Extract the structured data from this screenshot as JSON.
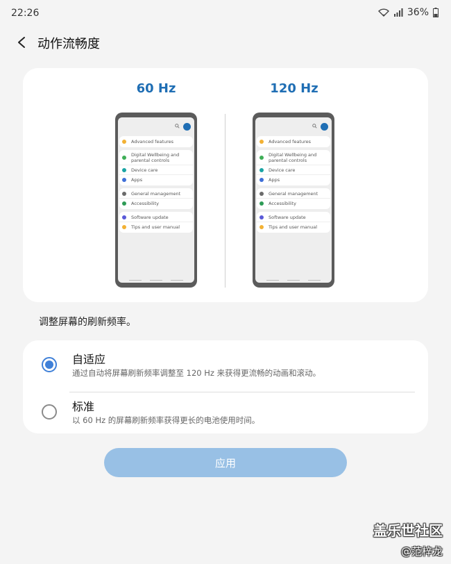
{
  "status_bar": {
    "time": "22:26",
    "battery": "36%"
  },
  "header": {
    "title": "动作流畅度"
  },
  "preview": {
    "left_label": "60 Hz",
    "right_label": "120 Hz",
    "settings_groups": [
      [
        {
          "label": "Advanced features",
          "icon": "gear-icon",
          "color": "#f2b134"
        }
      ],
      [
        {
          "label": "Digital Wellbeing and parental controls",
          "icon": "wellbeing-icon",
          "color": "#3fae57"
        },
        {
          "label": "Device care",
          "icon": "device-care-icon",
          "color": "#1aa4a4"
        },
        {
          "label": "Apps",
          "icon": "apps-icon",
          "color": "#3f6fd8"
        }
      ],
      [
        {
          "label": "General management",
          "icon": "sliders-icon",
          "color": "#6b6b6b"
        },
        {
          "label": "Accessibility",
          "icon": "accessibility-icon",
          "color": "#2e9b56"
        }
      ],
      [
        {
          "label": "Software update",
          "icon": "update-icon",
          "color": "#5a5ad8"
        },
        {
          "label": "Tips and user manual",
          "icon": "lightbulb-icon",
          "color": "#f2b134"
        }
      ]
    ]
  },
  "description": "调整屏幕的刷新频率。",
  "options": [
    {
      "title": "自适应",
      "subtitle": "通过自动将屏幕刷新频率调整至 120 Hz 来获得更流畅的动画和滚动。",
      "selected": true
    },
    {
      "title": "标准",
      "subtitle": "以 60 Hz 的屏幕刷新频率获得更长的电池使用时间。",
      "selected": false
    }
  ],
  "apply_label": "应用",
  "watermark": {
    "line1": "盖乐世社区",
    "line2": "@范梓龙"
  },
  "colors": {
    "accent": "#1f6eb4",
    "radio": "#3f80d8",
    "button": "#98c0e5"
  }
}
